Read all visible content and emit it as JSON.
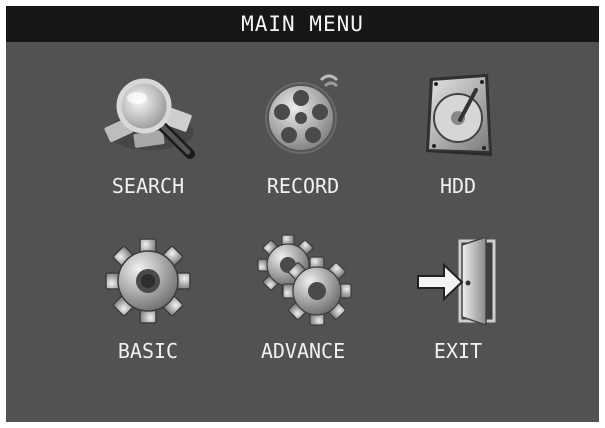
{
  "header": {
    "title": "MAIN MENU"
  },
  "menu": {
    "items": [
      {
        "label": "SEARCH",
        "icon": "magnifier-icon"
      },
      {
        "label": "RECORD",
        "icon": "film-reel-icon"
      },
      {
        "label": "HDD",
        "icon": "hard-drive-icon"
      },
      {
        "label": "BASIC",
        "icon": "gear-icon"
      },
      {
        "label": "ADVANCE",
        "icon": "gears-icon"
      },
      {
        "label": "EXIT",
        "icon": "exit-door-icon"
      }
    ]
  },
  "colors": {
    "background": "#525252",
    "titlebar": "#171717",
    "text": "#f0f0f0"
  }
}
